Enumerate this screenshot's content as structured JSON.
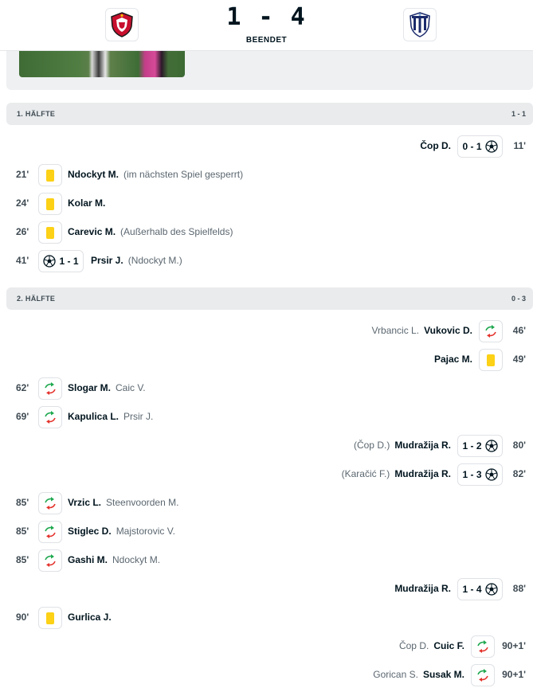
{
  "header": {
    "home_logo": "shield-red-crest-icon",
    "away_logo": "shield-blue-white-crest-icon",
    "score": "1 - 4",
    "status": "BEENDET"
  },
  "media": {
    "thumbnail": "match-video-thumbnail"
  },
  "sections": [
    {
      "label": "1. HÄLFTE",
      "score": "1 - 1"
    },
    {
      "label": "2. HÄLFTE",
      "score": "0 - 3"
    }
  ],
  "events": [
    {
      "side": "away",
      "minute": "11'",
      "type": "goal",
      "score": "0 - 1",
      "player": "Čop D.",
      "secondary": ""
    },
    {
      "side": "home",
      "minute": "21'",
      "type": "yellow",
      "player": "Ndockyt M.",
      "secondary": "(im nächsten Spiel gesperrt)"
    },
    {
      "side": "home",
      "minute": "24'",
      "type": "yellow",
      "player": "Kolar M.",
      "secondary": ""
    },
    {
      "side": "home",
      "minute": "26'",
      "type": "yellow",
      "player": "Carevic M.",
      "secondary": "(Außerhalb des Spielfelds)"
    },
    {
      "side": "home",
      "minute": "41'",
      "type": "goal",
      "score": "1 - 1",
      "player": "Prsir J.",
      "secondary": "(Ndockyt M.)"
    },
    {
      "side": "away",
      "minute": "46'",
      "type": "sub",
      "player": "Vukovic D.",
      "secondary": "Vrbancic L."
    },
    {
      "side": "away",
      "minute": "49'",
      "type": "yellow",
      "player": "Pajac M.",
      "secondary": ""
    },
    {
      "side": "home",
      "minute": "62'",
      "type": "sub",
      "player": "Slogar M.",
      "secondary": "Caic V."
    },
    {
      "side": "home",
      "minute": "69'",
      "type": "sub",
      "player": "Kapulica L.",
      "secondary": "Prsir J."
    },
    {
      "side": "away",
      "minute": "80'",
      "type": "goal",
      "score": "1 - 2",
      "player": "Mudražija R.",
      "secondary": "(Čop D.)"
    },
    {
      "side": "away",
      "minute": "82'",
      "type": "goal",
      "score": "1 - 3",
      "player": "Mudražija R.",
      "secondary": "(Karačić F.)"
    },
    {
      "side": "home",
      "minute": "85'",
      "type": "sub",
      "player": "Vrzic L.",
      "secondary": "Steenvoorden M."
    },
    {
      "side": "home",
      "minute": "85'",
      "type": "sub",
      "player": "Stiglec D.",
      "secondary": "Majstorovic V."
    },
    {
      "side": "home",
      "minute": "85'",
      "type": "sub",
      "player": "Gashi M.",
      "secondary": "Ndockyt M."
    },
    {
      "side": "away",
      "minute": "88'",
      "type": "goal",
      "score": "1 - 4",
      "player": "Mudražija R.",
      "secondary": ""
    },
    {
      "side": "home",
      "minute": "90'",
      "type": "yellow",
      "player": "Gurlica J.",
      "secondary": ""
    },
    {
      "side": "away",
      "minute": "90+1'",
      "type": "sub",
      "player": "Cuic F.",
      "secondary": "Čop D."
    },
    {
      "side": "away",
      "minute": "90+1'",
      "type": "sub",
      "player": "Susak M.",
      "secondary": "Gorican S."
    }
  ],
  "colors": {
    "yellow_card": "#fcd116",
    "sub_in": "#1fa84f",
    "sub_out": "#e4322b",
    "section_bg": "#e9ebed"
  }
}
